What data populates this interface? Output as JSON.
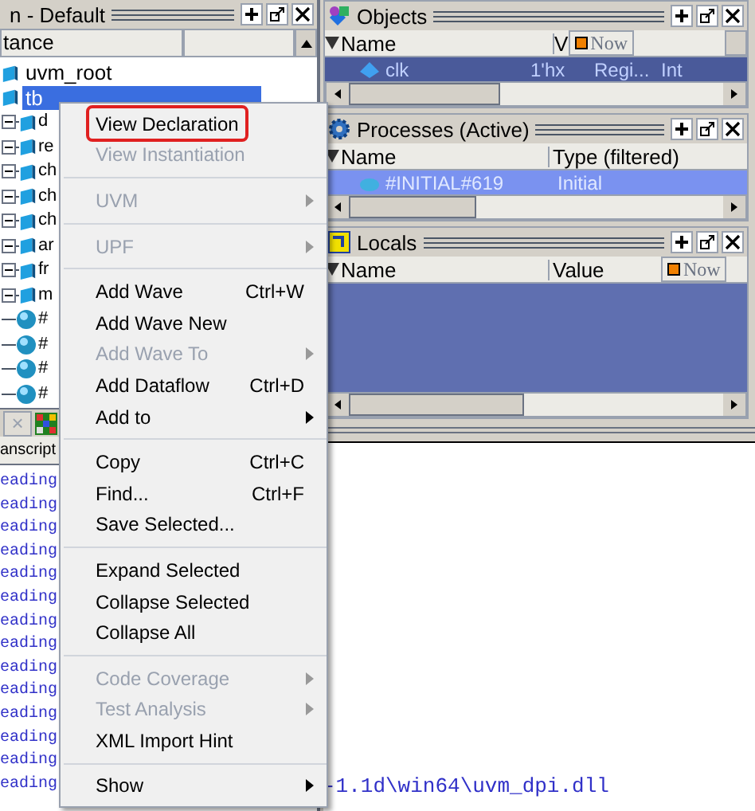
{
  "sim_pane": {
    "title": "n - Default",
    "column": "tance",
    "tree": [
      {
        "label": "uvm_root",
        "kind": "module",
        "selected": false
      },
      {
        "label": "tb",
        "kind": "module",
        "selected": true,
        "children": [
          {
            "label": "d",
            "kind": "instance",
            "selected": false
          },
          {
            "label": "re",
            "kind": "instance",
            "selected": false
          },
          {
            "label": "ch",
            "kind": "instance",
            "selected": false
          },
          {
            "label": "ch",
            "kind": "instance",
            "selected": false
          },
          {
            "label": "ch",
            "kind": "instance",
            "selected": false
          },
          {
            "label": "ar",
            "kind": "instance",
            "selected": false
          },
          {
            "label": "fr",
            "kind": "instance",
            "selected": false
          },
          {
            "label": "m",
            "kind": "instance",
            "selected": false
          },
          {
            "label": "#",
            "kind": "process",
            "selected": false
          },
          {
            "label": "#",
            "kind": "process",
            "selected": false
          },
          {
            "label": "#",
            "kind": "process",
            "selected": false
          },
          {
            "label": "#",
            "kind": "process",
            "selected": false
          }
        ]
      }
    ],
    "tab_close": "×"
  },
  "transcript": {
    "title": "anscript",
    "lines": [
      "eading",
      "eading",
      "eading",
      "eading",
      "eading",
      "eading",
      "eading",
      "eading",
      "eading",
      "eading",
      "eading",
      "eading",
      "eading",
      "eading"
    ],
    "tail": "-1.1d\\win64\\uvm_dpi.dll"
  },
  "objects": {
    "title": "Objects",
    "columns": [
      "Name",
      "V"
    ],
    "now": "Now",
    "rows": [
      {
        "cells": [
          "clk",
          "1'hx",
          "Regi...",
          "Int"
        ],
        "selected": true
      }
    ]
  },
  "processes": {
    "title": "Processes (Active)",
    "columns": [
      "Name",
      "Type (filtered)"
    ],
    "rows": [
      {
        "cells": [
          "#INITIAL#619",
          "Initial"
        ],
        "selected": true
      }
    ]
  },
  "locals": {
    "title": "Locals",
    "columns": [
      "Name",
      "Value"
    ],
    "now": "Now"
  },
  "context_menu": [
    {
      "kind": "item",
      "label": "View Declaration",
      "disabled": false,
      "highlighted": true
    },
    {
      "kind": "item",
      "label": "View Instantiation",
      "disabled": true,
      "highlighted": false
    },
    {
      "kind": "separator"
    },
    {
      "kind": "item",
      "label": "UVM",
      "disabled": true,
      "highlighted": false,
      "submenu": true
    },
    {
      "kind": "separator"
    },
    {
      "kind": "item",
      "label": "UPF",
      "disabled": true,
      "highlighted": false,
      "submenu": true
    },
    {
      "kind": "separator"
    },
    {
      "kind": "item",
      "label": "Add Wave",
      "shortcut": "Ctrl+W",
      "disabled": false,
      "highlighted": false
    },
    {
      "kind": "item",
      "label": "Add Wave New",
      "disabled": false,
      "highlighted": false
    },
    {
      "kind": "item",
      "label": "Add Wave To",
      "disabled": true,
      "highlighted": false,
      "submenu": true
    },
    {
      "kind": "item",
      "label": "Add Dataflow",
      "shortcut": "Ctrl+D",
      "disabled": false,
      "highlighted": false
    },
    {
      "kind": "item",
      "label": "Add to",
      "disabled": false,
      "highlighted": false,
      "submenu": true
    },
    {
      "kind": "separator"
    },
    {
      "kind": "item",
      "label": "Copy",
      "shortcut": "Ctrl+C",
      "disabled": false,
      "highlighted": false
    },
    {
      "kind": "item",
      "label": "Find...",
      "shortcut": "Ctrl+F",
      "disabled": false,
      "highlighted": false
    },
    {
      "kind": "item",
      "label": "Save Selected...",
      "disabled": false,
      "highlighted": false
    },
    {
      "kind": "separator"
    },
    {
      "kind": "item",
      "label": "Expand Selected",
      "disabled": false,
      "highlighted": false
    },
    {
      "kind": "item",
      "label": "Collapse Selected",
      "disabled": false,
      "highlighted": false
    },
    {
      "kind": "item",
      "label": "Collapse All",
      "disabled": false,
      "highlighted": false
    },
    {
      "kind": "separator"
    },
    {
      "kind": "item",
      "label": "Code Coverage",
      "disabled": true,
      "highlighted": false,
      "submenu": true
    },
    {
      "kind": "item",
      "label": "Test Analysis",
      "disabled": true,
      "highlighted": false,
      "submenu": true
    },
    {
      "kind": "item",
      "label": "XML Import Hint",
      "disabled": false,
      "highlighted": false
    },
    {
      "kind": "separator"
    },
    {
      "kind": "item",
      "label": "Show",
      "disabled": false,
      "highlighted": false,
      "submenu": true
    }
  ]
}
